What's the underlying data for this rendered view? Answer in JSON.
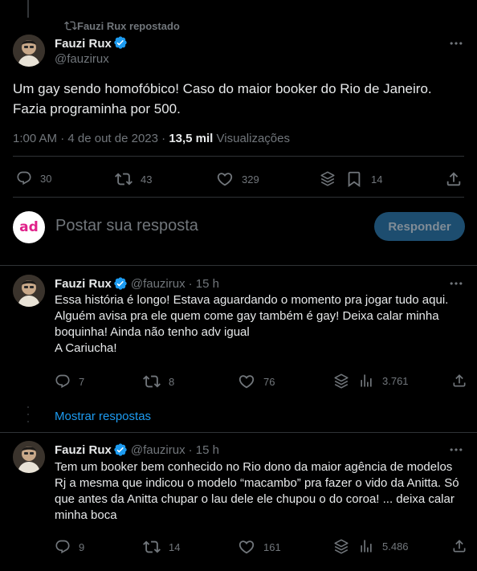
{
  "repost_label": "Fauzi Rux repostado",
  "main_tweet": {
    "name": "Fauzi Rux",
    "handle": "@fauzirux",
    "text": "Um gay sendo homofóbico! Caso do maior booker do Rio de Janeiro. Fazia programinha por 500.",
    "time": "1:00 AM · 4 de out de 2023 ·",
    "views_count": "13,5 mil",
    "views_label": "Visualizações",
    "replies": "30",
    "reposts": "43",
    "likes": "329",
    "bookmarks": "14"
  },
  "compose": {
    "avatar_text": "ad",
    "placeholder": "Postar sua resposta",
    "button_label": "Responder"
  },
  "replies": [
    {
      "name": "Fauzi Rux",
      "handle": "@fauzirux",
      "age": "· 15 h",
      "text": "Essa história é longo! Estava aguardando o momento pra jogar tudo aqui.\nAlguém avisa pra ele quem come gay também é gay! Deixa calar minha boquinha! Ainda não tenho adv igual\nA Cariucha!",
      "replies": "7",
      "reposts": "8",
      "likes": "76",
      "views": "3.761"
    },
    {
      "name": "Fauzi Rux",
      "handle": "@fauzirux",
      "age": "· 15 h",
      "text": "Tem um booker bem conhecido no Rio dono da maior agência de modelos Rj a mesma que indicou o modelo “macambo” pra fazer o vido da Anitta. Só que antes da Anitta chupar o lau dele ele chupou o do coroa! ... deixa calar minha boca",
      "replies": "9",
      "reposts": "14",
      "likes": "161",
      "views": "5.486"
    }
  ],
  "show_replies_label": "Mostrar respostas",
  "colors": {
    "background": "#000000",
    "text": "#e7e9ea",
    "muted": "#71767b",
    "accent": "#1d9bf0",
    "verified": "#1d9bf0",
    "reply_button": "#1d4d6f"
  },
  "icons": [
    "repost-icon",
    "verified-badge-icon",
    "more-icon",
    "reply-icon",
    "like-icon",
    "grok-icon",
    "bookmark-icon",
    "share-icon",
    "views-icon"
  ]
}
